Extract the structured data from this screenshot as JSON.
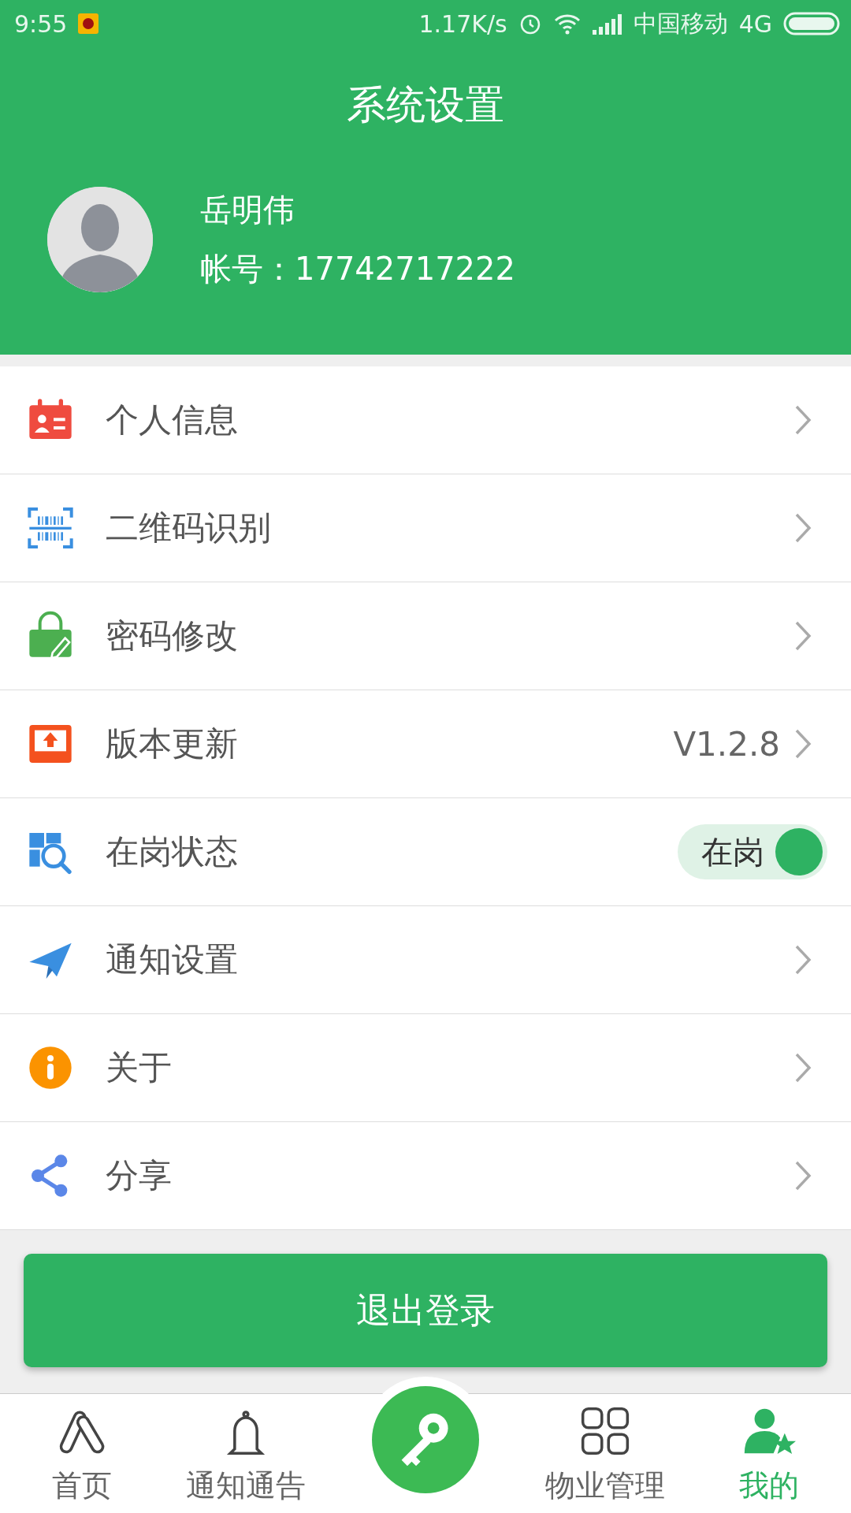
{
  "status_bar": {
    "time": "9:55",
    "speed": "1.17K/s",
    "carrier": "中国移动",
    "network": "4G"
  },
  "header": {
    "title": "系统设置"
  },
  "profile": {
    "name": "岳明伟",
    "account": "帐号：17742717222"
  },
  "menu": [
    {
      "kind": "arrow",
      "label": "个人信息"
    },
    {
      "kind": "arrow",
      "label": "二维码识别"
    },
    {
      "kind": "arrow",
      "label": "密码修改"
    },
    {
      "kind": "value",
      "label": "版本更新",
      "value": "V1.2.8"
    },
    {
      "kind": "toggle",
      "label": "在岗状态",
      "toggle_label": "在岗",
      "on": true
    },
    {
      "kind": "arrow",
      "label": "通知设置"
    },
    {
      "kind": "arrow",
      "label": "关于"
    },
    {
      "kind": "arrow",
      "label": "分享"
    }
  ],
  "logout_button": "退出登录",
  "bottom_nav": [
    {
      "label": "首页",
      "selected": false
    },
    {
      "label": "通知通告",
      "selected": false
    },
    {
      "label": "物业管理",
      "selected": false
    },
    {
      "label": "我的",
      "selected": true
    }
  ]
}
